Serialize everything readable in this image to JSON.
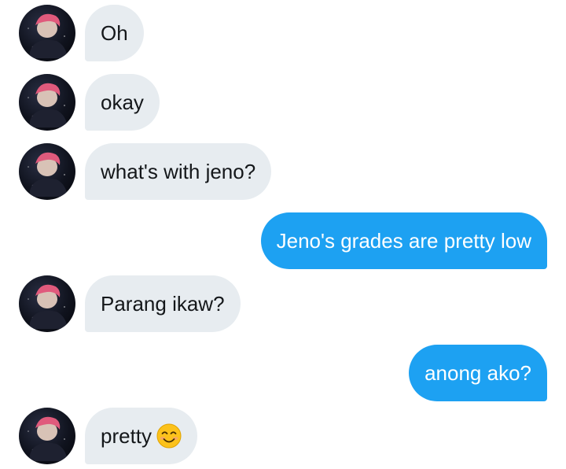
{
  "messages": [
    {
      "from": "them",
      "text": "Oh"
    },
    {
      "from": "them",
      "text": "okay"
    },
    {
      "from": "them",
      "text": "what's with jeno?"
    },
    {
      "from": "me",
      "text": "Jeno's grades are pretty low"
    },
    {
      "from": "them",
      "text": "Parang ikaw?"
    },
    {
      "from": "me",
      "text": "anong ako?"
    },
    {
      "from": "them",
      "text": "pretty",
      "emoji": "smiling-face-emoji"
    }
  ],
  "colors": {
    "incoming_bubble": "#e7ecf0",
    "outgoing_bubble": "#1da1f2",
    "incoming_text": "#14171a",
    "outgoing_text": "#ffffff"
  },
  "avatar_icon": "profile-avatar-icon"
}
